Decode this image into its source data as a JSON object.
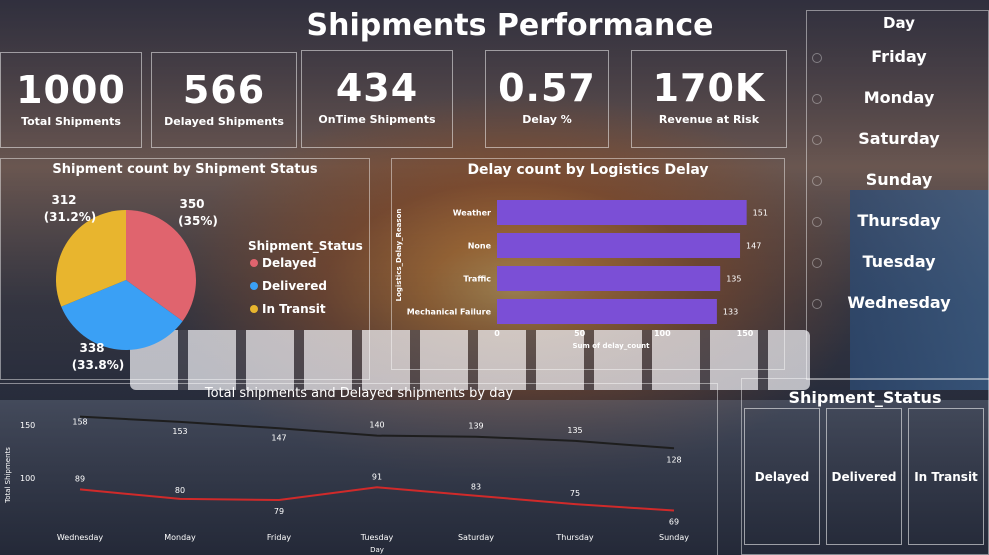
{
  "dashboard": {
    "title": "Shipments Performance",
    "kpis": [
      {
        "value": "1000",
        "label": "Total Shipments"
      },
      {
        "value": "566",
        "label": "Delayed Shipments"
      },
      {
        "value": "434",
        "label": "OnTime Shipments"
      },
      {
        "value": "0.57",
        "label": "Delay %"
      },
      {
        "value": "170K",
        "label": "Revenue at Risk"
      }
    ],
    "day_slicer": {
      "title": "Day",
      "items": [
        "Friday",
        "Monday",
        "Saturday",
        "Sunday",
        "Thursday",
        "Tuesday",
        "Wednesday"
      ]
    },
    "status_slicer": {
      "title": "Shipment_Status",
      "items": [
        "Delayed",
        "Delivered",
        "In Transit"
      ]
    }
  },
  "chart_data": [
    {
      "type": "pie",
      "title": "Shipment count by Shipment Status",
      "legend_title": "Shipment_Status",
      "categories": [
        "Delayed",
        "Delivered",
        "In Transit"
      ],
      "values": [
        350,
        338,
        312
      ],
      "value_labels": [
        "350",
        "338",
        "312"
      ],
      "percent_labels": [
        "(35%)",
        "(33.8%)",
        "(31.2%)"
      ],
      "colors": [
        "#e0646e",
        "#3aa0f5",
        "#e8b52e"
      ],
      "legend_position": "right"
    },
    {
      "type": "bar",
      "orientation": "horizontal",
      "title": "Delay count by Logistics Delay",
      "categories": [
        "Weather",
        "None",
        "Traffic",
        "Mechanical Failure"
      ],
      "values": [
        151,
        147,
        135,
        133
      ],
      "xlabel": "Sum of delay_count",
      "ylabel": "Logistics_Delay_Reason",
      "xlim": [
        0,
        150
      ],
      "xticks": [
        "0",
        "50",
        "100",
        "150"
      ],
      "color": "#7b4fd6"
    },
    {
      "type": "line",
      "title": "Total shipments and Delayed shipments by day",
      "categories": [
        "Wednesday",
        "Monday",
        "Friday",
        "Tuesday",
        "Saturday",
        "Thursday",
        "Sunday"
      ],
      "series": [
        {
          "values": [
            158,
            153,
            147,
            140,
            139,
            135,
            128
          ],
          "color": "#1e1e1e"
        },
        {
          "values": [
            89,
            80,
            79,
            91,
            83,
            75,
            69
          ],
          "color": "#d02a2a"
        }
      ],
      "xlabel": "Day",
      "ylabel": "Total Shipments",
      "yticks": [
        "150",
        "100"
      ],
      "ylim": [
        60,
        170
      ]
    }
  ]
}
